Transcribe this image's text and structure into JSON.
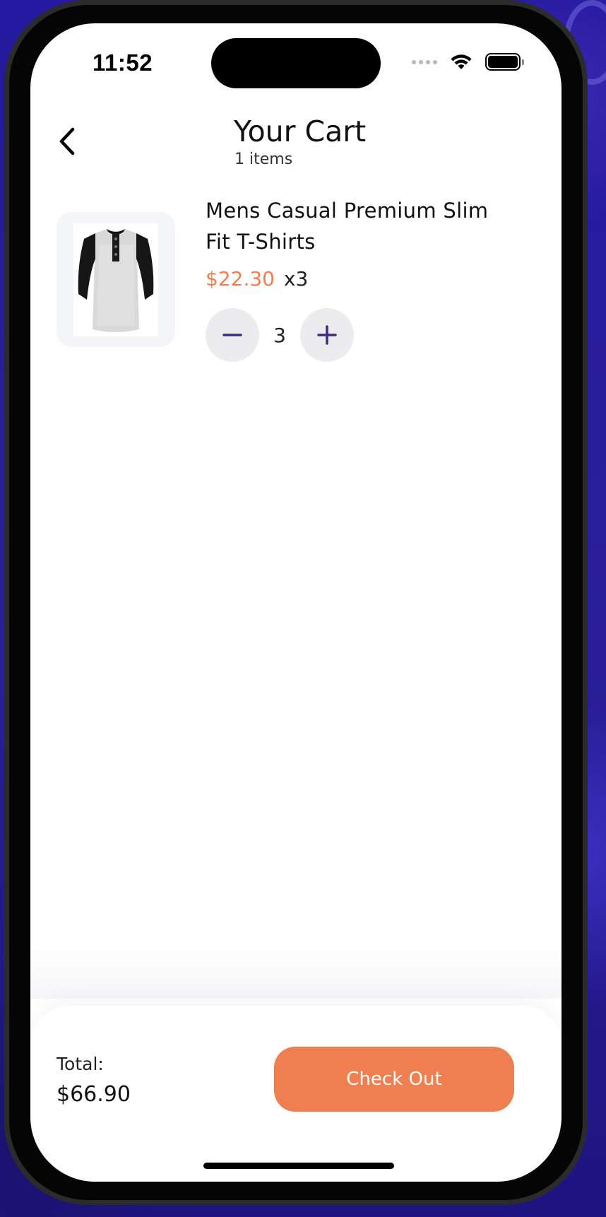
{
  "status_bar": {
    "time": "11:52"
  },
  "header": {
    "title": "Your Cart",
    "item_count": "1 items"
  },
  "cart": {
    "items": [
      {
        "title": "Mens Casual Premium Slim Fit T-Shirts",
        "price": "$22.30",
        "multiplier": "x3",
        "quantity": "3"
      }
    ]
  },
  "footer": {
    "total_label": "Total:",
    "total_value": "$66.90",
    "checkout_label": "Check Out"
  },
  "colors": {
    "accent": "#EF7F50",
    "icon_purple": "#3F2B7F",
    "background_purple": "#2A1C8C"
  },
  "icons": {
    "back": "chevron-left-icon",
    "minus": "minus-icon",
    "plus": "plus-icon"
  }
}
